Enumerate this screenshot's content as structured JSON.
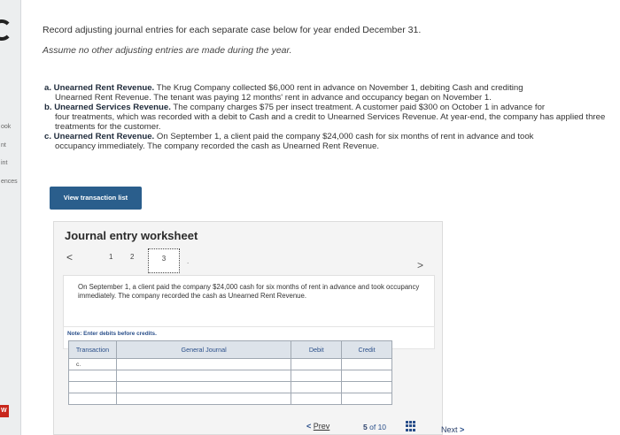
{
  "sidebar": {
    "items": [
      "ook",
      "nt",
      "int",
      "ences"
    ],
    "badge": "W"
  },
  "prompt": {
    "line1": "Record adjusting journal entries for each separate case below for year ended December 31.",
    "line2": "Assume no other adjusting entries are made during the year."
  },
  "cases": [
    {
      "label": "a. Unearned Rent Revenue.",
      "text_first": " The Krug Company collected $6,000 rent in advance on November 1, debiting Cash and crediting",
      "text_rest": "Unearned Rent Revenue. The tenant was paying 12 months' rent in advance and occupancy began on November 1."
    },
    {
      "label": "b. Unearned Services Revenue.",
      "text_first": " The company charges $75 per insect treatment. A customer paid $300 on October 1 in advance for",
      "text_rest": "four treatments, which was recorded with a debit to Cash and a credit to Unearned Services Revenue. At year-end, the company has applied three treatments for the customer."
    },
    {
      "label": "c. Unearned Rent Revenue.",
      "text_first": " On September 1, a client paid the company $24,000 cash for six months of rent in advance and took",
      "text_rest": "occupancy immediately. The company recorded the cash as Unearned Rent Revenue."
    }
  ],
  "view_transaction_list": "View transaction list",
  "worksheet": {
    "title": "Journal entry worksheet",
    "pager": {
      "prev": "<",
      "pages": [
        "1",
        "2",
        "3"
      ],
      "current": "3",
      "next": ">"
    },
    "description": "On September 1, a client paid the company $24,000 cash for six months of rent in advance and took occupancy immediately. The company recorded the cash as Unearned Rent Revenue.",
    "note": "Note: Enter debits before credits.",
    "table": {
      "headers": [
        "Transaction",
        "General Journal",
        "Debit",
        "Credit"
      ],
      "rows": [
        [
          "c.",
          "",
          "",
          ""
        ],
        [
          "",
          "",
          "",
          ""
        ],
        [
          "",
          "",
          "",
          ""
        ],
        [
          "",
          "",
          "",
          ""
        ]
      ]
    }
  },
  "footer": {
    "prev": "Prev",
    "current_page": "5",
    "of": "of",
    "total_pages": "10",
    "next": "Next"
  }
}
